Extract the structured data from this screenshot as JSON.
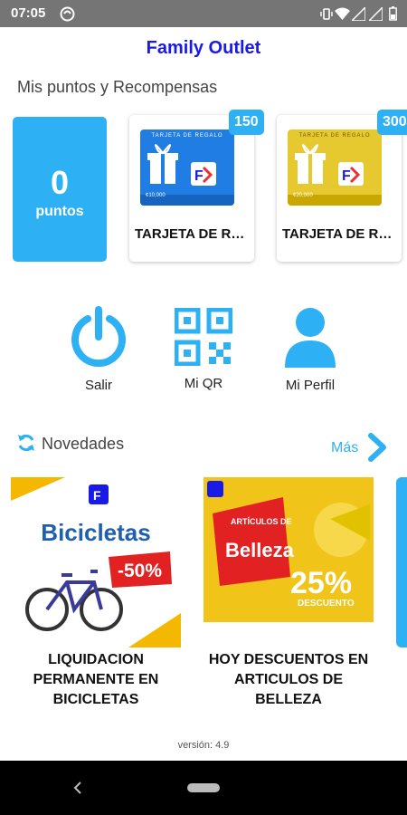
{
  "status_bar": {
    "time": "07:05"
  },
  "app": {
    "title": "Family Outlet"
  },
  "rewards": {
    "section_title": "Mis puntos y Recompensas",
    "points_value": "0",
    "points_label": "puntos",
    "items": [
      {
        "badge": "150",
        "name": "TARJETA DE REGALO",
        "card_header": "TARJETA DE REGALO",
        "card_amount": "¢10,000",
        "card_color": "#1f7de3"
      },
      {
        "badge": "300",
        "name": "TARJETA DE REGALO",
        "card_header": "TARJETA DE REGALO",
        "card_amount": "¢20,000",
        "card_color": "#e6c92e"
      }
    ]
  },
  "actions": [
    {
      "label": "Salir",
      "icon": "power-icon"
    },
    {
      "label": "Mi QR",
      "icon": "qr-code-icon"
    },
    {
      "label": "Mi Perfil",
      "icon": "user-icon"
    }
  ],
  "news": {
    "header": "Novedades",
    "more_label": "Más",
    "items": [
      {
        "title": "LIQUIDACION PERMANENTE EN BICICLETAS",
        "image_heading": "Bicicletas",
        "image_discount": "-50%"
      },
      {
        "title": "HOY DESCUENTOS EN ARTICULOS DE BELLEZA",
        "image_heading": "Belleza",
        "image_sub": "ARTÍCULOS DE",
        "image_discount": "25%",
        "image_discount_label": "DESCUENTO"
      }
    ]
  },
  "footer": {
    "version": "versión: 4.9"
  },
  "colors": {
    "accent": "#2db0f4",
    "title": "#1a1ae6"
  }
}
